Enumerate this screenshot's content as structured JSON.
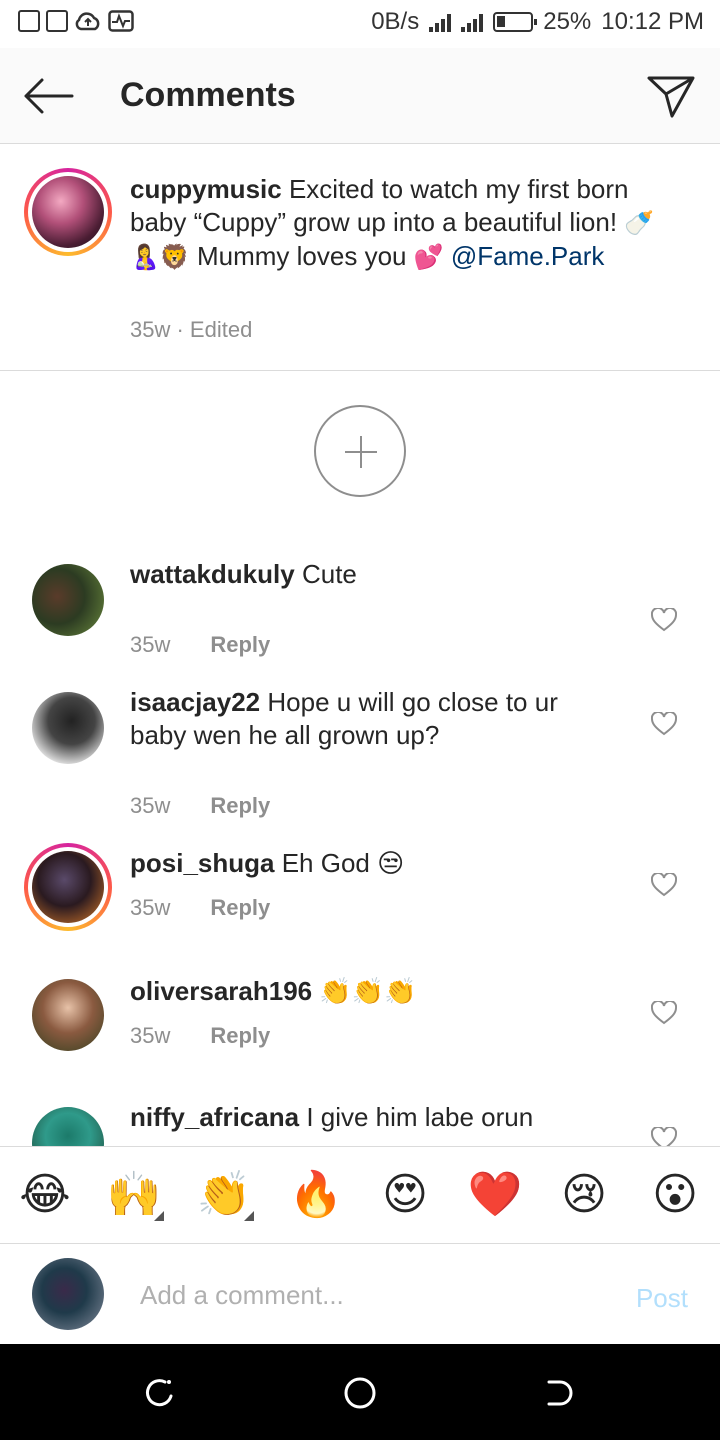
{
  "status_bar": {
    "network_speed": "0B/s",
    "battery_percent": "25%",
    "time": "10:12 PM",
    "icons": [
      "message-icon",
      "image-icon",
      "cloud-upload-icon",
      "activity-icon",
      "signal-icon",
      "signal-h-icon",
      "battery-icon"
    ]
  },
  "header": {
    "title": "Comments",
    "back_icon": "arrow-left-icon",
    "send_icon": "paper-plane-icon"
  },
  "caption": {
    "username": "cuppymusic",
    "text_part1": "Excited to watch my first born baby “Cuppy” grow up into a beautiful lion! ",
    "emojis_1": "🍼🤱🦁",
    "text_part2": " Mummy loves you ",
    "emojis_2": "💕",
    "mention": "@Fame.Park",
    "age": "35w",
    "edited": "Edited"
  },
  "comments": [
    {
      "username": "wattakdukuly",
      "text": "Cute",
      "age": "35w",
      "reply": "Reply"
    },
    {
      "username": "isaacjay22",
      "text": "Hope u will go close to ur baby wen he all grown up?",
      "age": "35w",
      "reply": "Reply"
    },
    {
      "username": "posi_shuga",
      "text": "Eh God 😒",
      "age": "35w",
      "reply": "Reply"
    },
    {
      "username": "oliversarah196",
      "text": "👏👏👏",
      "age": "35w",
      "reply": "Reply"
    },
    {
      "username": "niffy_africana",
      "text": "I give him labe orun",
      "age": "",
      "reply": ""
    }
  ],
  "emoji_bar": [
    "😂",
    "🙌",
    "👏",
    "🔥",
    "😍",
    "❤️",
    "😢",
    "😮"
  ],
  "add_comment": {
    "placeholder": "Add a comment...",
    "post_label": "Post"
  },
  "colors": {
    "accent_link": "#003569",
    "post_disabled": "#b2dffc",
    "meta_gray": "#8e8e8e",
    "heart_red": "#ed1c24"
  }
}
